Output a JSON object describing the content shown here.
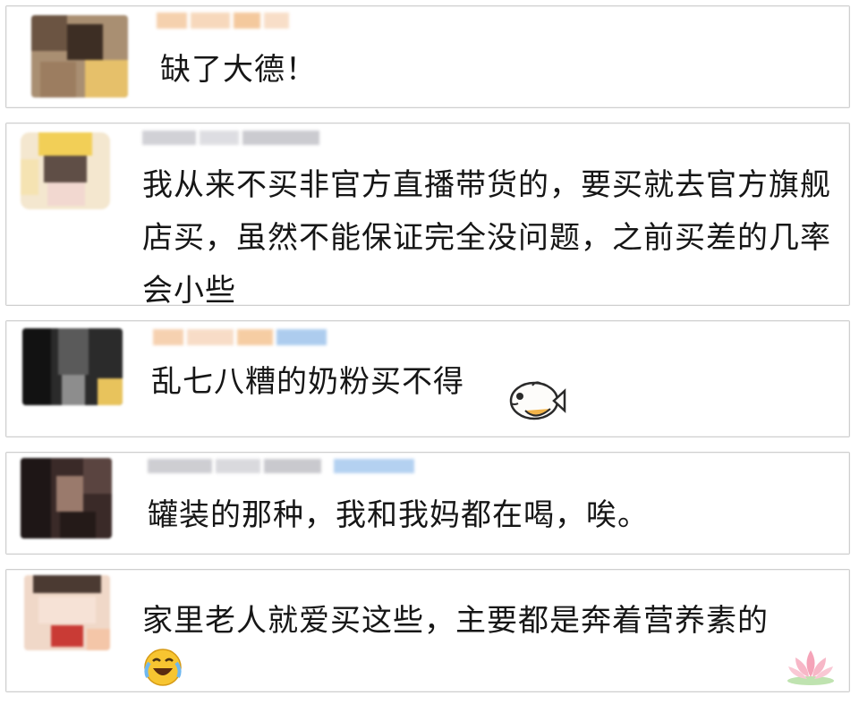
{
  "comments": [
    {
      "text": "缺了大德！"
    },
    {
      "text": "我从来不买非官方直播带货的，要买就去官方旗舰店买，虽然不能保证完全没问题，之前买差的几率会小些"
    },
    {
      "text": "乱七八糟的奶粉买不得",
      "emoji": "fish-emoji"
    },
    {
      "text": "罐装的那种，我和我妈都在喝，唉。"
    },
    {
      "text": "家里老人就爱买这些，主要都是奔着营养素的",
      "emoji": "laughing-crying-emoji",
      "sticker": "lotus-sticker"
    }
  ]
}
